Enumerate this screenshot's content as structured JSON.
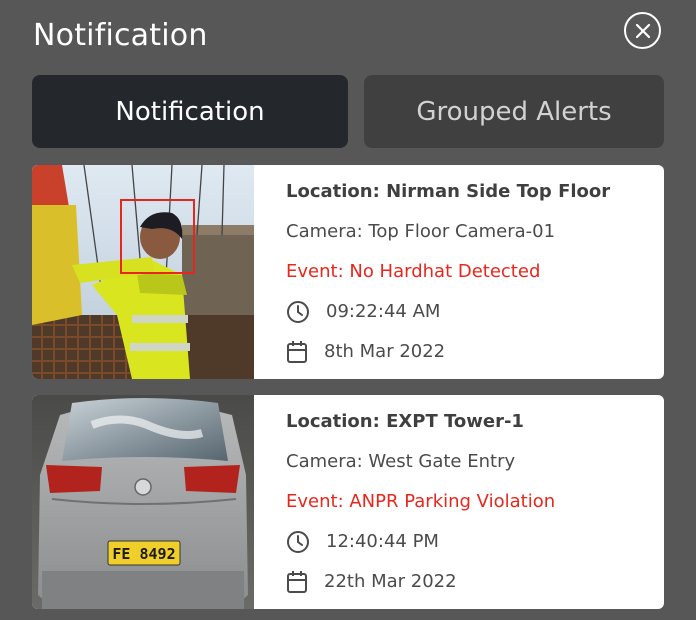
{
  "header": {
    "title": "Notification"
  },
  "tabs": [
    {
      "label": "Notification",
      "active": true
    },
    {
      "label": "Grouped Alerts",
      "active": false
    }
  ],
  "notifications": [
    {
      "location": "Location: Nirman Side Top Floor",
      "camera": "Camera: Top Floor Camera-01",
      "event": "Event: No Hardhat Detected",
      "time": "09:22:44 AM",
      "date": "8th Mar 2022"
    },
    {
      "location": "Location: EXPT Tower-1",
      "camera": "Camera: West Gate Entry",
      "event": "Event: ANPR Parking Violation",
      "time": "12:40:44 PM",
      "date": "22th Mar 2022",
      "plate": "FE 8492"
    }
  ],
  "colors": {
    "background": "#575757",
    "active_tab": "#24282c",
    "inactive_tab": "#404040",
    "event": "#e8271c",
    "detection_box": "#e8271c"
  },
  "icons": {
    "close": "close-icon",
    "time": "clock-icon",
    "date": "calendar-icon"
  }
}
